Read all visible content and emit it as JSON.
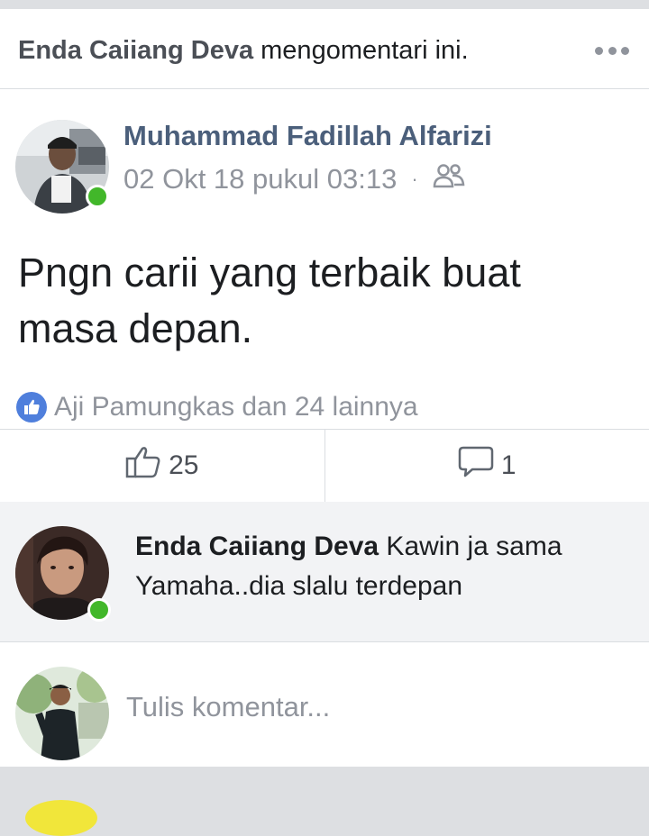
{
  "activity": {
    "actor": "Enda Caiiang Deva",
    "action": " mengomentari ini.",
    "menu_icon": "more-dots-icon"
  },
  "post": {
    "author": "Muhammad Fadillah Alfarizi",
    "timestamp": "02 Okt 18 pukul 03:13",
    "separator": "·",
    "privacy_icon": "friends-icon",
    "text": "Pngn carii yang terbaik buat masa depan.",
    "reactions_summary": "Aji Pamungkas dan 24 lainnya"
  },
  "actions": {
    "like_count": "25",
    "comment_count": "1"
  },
  "comment": {
    "author": "Enda Caiiang Deva",
    "text": " Kawin ja sama Yamaha..dia slalu terdepan"
  },
  "composer": {
    "placeholder": "Tulis komentar..."
  },
  "colors": {
    "online": "#42b72a",
    "like_badge": "#4f7fdc",
    "name": "#4b5f7b"
  }
}
